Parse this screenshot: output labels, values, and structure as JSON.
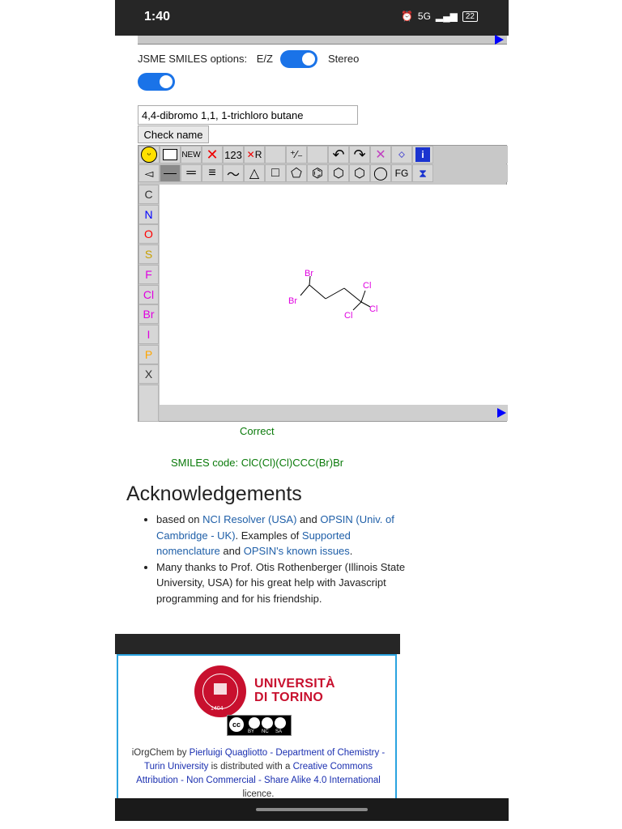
{
  "status_bar": {
    "time": "1:40",
    "network": "5G",
    "battery": "22"
  },
  "smiles_options": {
    "label": "JSME SMILES options:",
    "ez_label": "E/Z",
    "stereo_label": "Stereo"
  },
  "name_input": {
    "value": "4,4-dibromo 1,1, 1-trichloro butane"
  },
  "check_button": {
    "label": "Check name"
  },
  "jsme": {
    "toolbar_row1": [
      "NEW",
      "123",
      "R"
    ],
    "fg_label": "FG",
    "atoms": [
      {
        "symbol": "C",
        "color": "#333333"
      },
      {
        "symbol": "N",
        "color": "#0000ff"
      },
      {
        "symbol": "O",
        "color": "#ff0000"
      },
      {
        "symbol": "S",
        "color": "#c8a000"
      },
      {
        "symbol": "F",
        "color": "#e000e0"
      },
      {
        "symbol": "Cl",
        "color": "#e000e0"
      },
      {
        "symbol": "Br",
        "color": "#e000e0"
      },
      {
        "symbol": "I",
        "color": "#e000e0"
      },
      {
        "symbol": "P",
        "color": "#ffa500"
      },
      {
        "symbol": "X",
        "color": "#333333"
      }
    ],
    "molecule_labels": {
      "br_top": "Br",
      "br_left": "Br",
      "cl_top": "Cl",
      "cl_right": "Cl",
      "cl_bottom": "Cl"
    }
  },
  "result": {
    "status": "Correct",
    "smiles": "SMILES code: ClC(Cl)(Cl)CCC(Br)Br"
  },
  "acknowledgements": {
    "title": "Acknowledgements",
    "item1": {
      "t1": "based on ",
      "l1": "NCI Resolver (USA)",
      "t2": " and ",
      "l2": "OPSIN (Univ. of Cambridge - UK)",
      "t3": ". Examples of ",
      "l3": "Supported nomenclature",
      "t4": " and ",
      "l4": "OPSIN's known issues",
      "t5": "."
    },
    "item2": "Many thanks to Prof. Otis Rothenberger (Illinois State University, USA) for his great help with Javascript programming and for his friendship."
  },
  "footer": {
    "uni_line1": "UNIVERSITÀ",
    "uni_line2": "DI TORINO",
    "seal_year": "1404",
    "cc_tags": [
      "BY",
      "NC",
      "SA"
    ],
    "t1": "iOrgChem by ",
    "l1": "Pierluigi Quagliotto - Department of Chemistry - Turin University",
    "t2": " is distributed with a ",
    "l2": "Creative Commons Attribution - Non Commercial - Share Alike 4.0 International",
    "t3": " licence."
  }
}
